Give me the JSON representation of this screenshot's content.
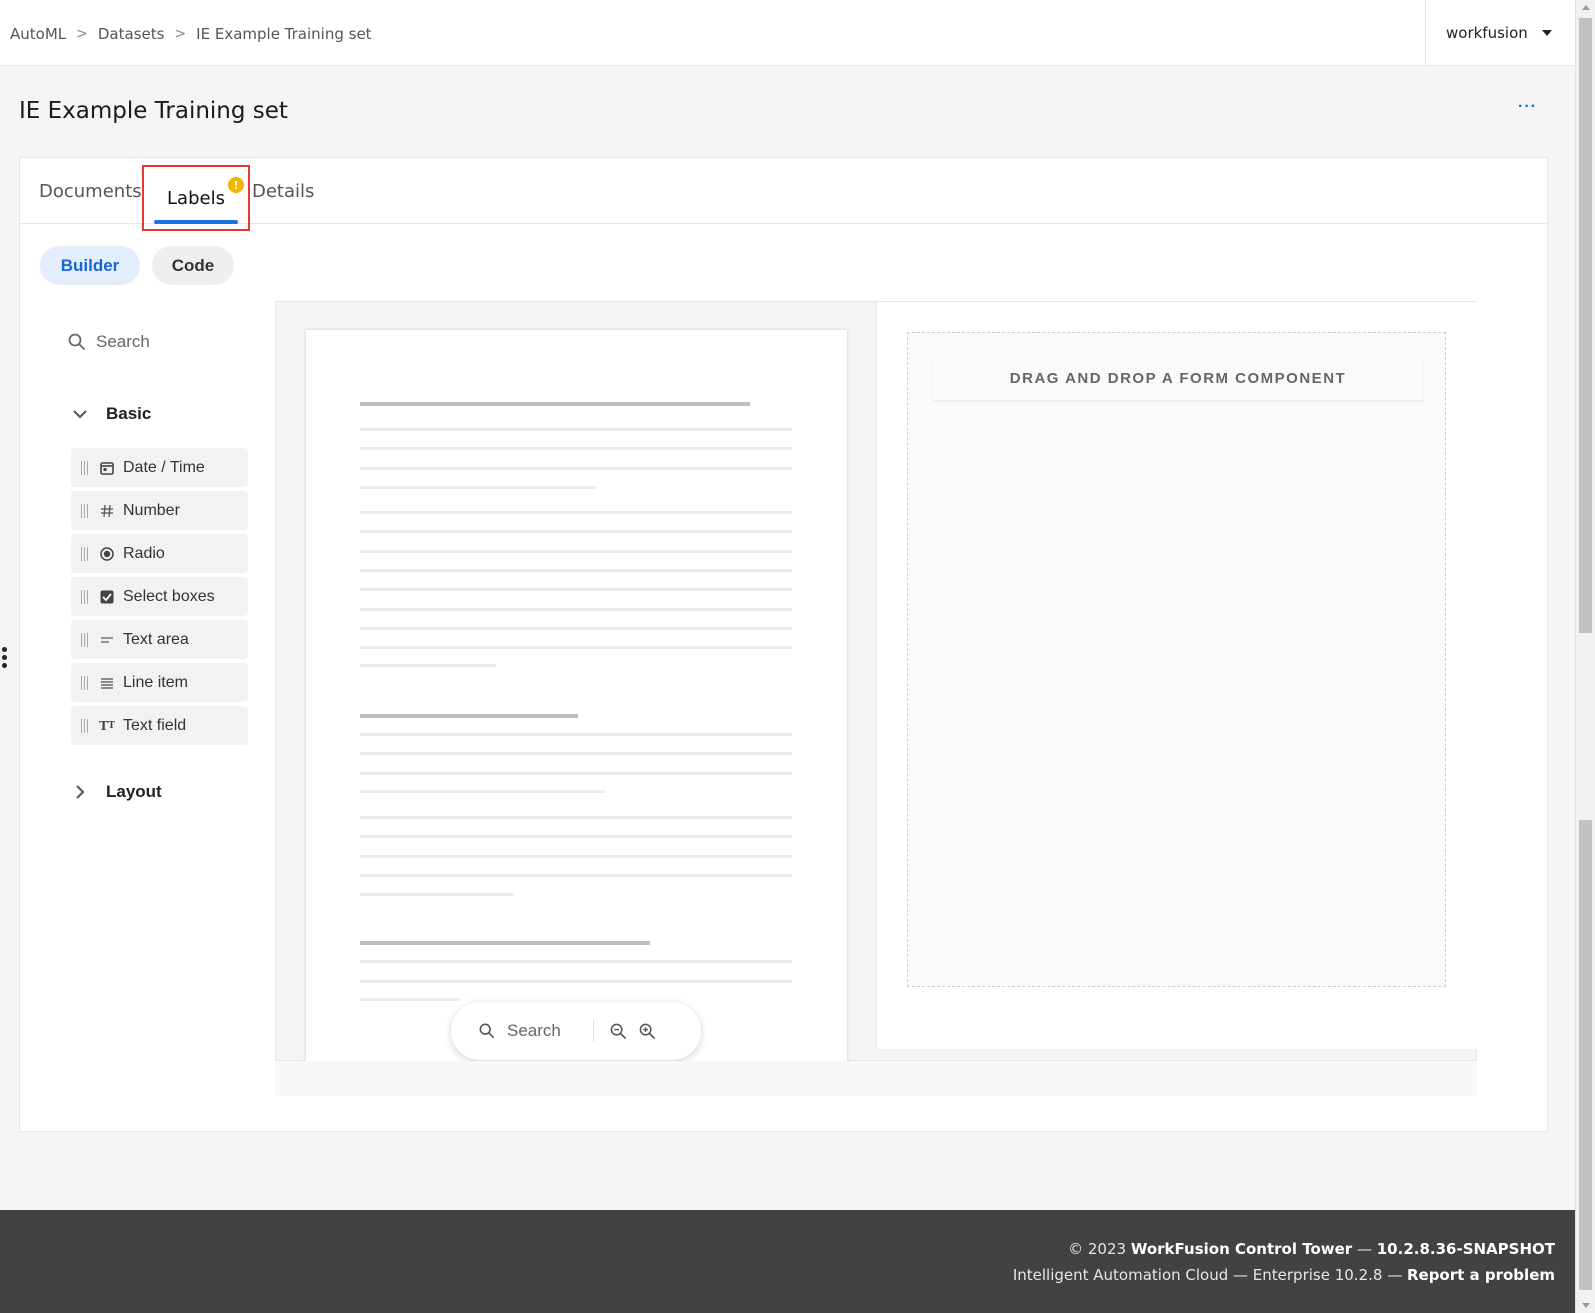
{
  "breadcrumb": [
    "AutoML",
    "Datasets",
    "IE Example Training set"
  ],
  "user": {
    "name": "workfusion"
  },
  "page": {
    "title": "IE Example Training set",
    "more_label": "···"
  },
  "tabs": [
    {
      "label": "Documents"
    },
    {
      "label": "Labels",
      "badge": "!"
    },
    {
      "label": "Details"
    }
  ],
  "modes": {
    "builder": "Builder",
    "code": "Code"
  },
  "sidebar": {
    "search_placeholder": "Search",
    "groups": {
      "basic": "Basic",
      "layout": "Layout"
    },
    "components": [
      {
        "label": "Date / Time",
        "icon": "calendar-icon"
      },
      {
        "label": "Number",
        "icon": "hash-icon"
      },
      {
        "label": "Radio",
        "icon": "radio-icon"
      },
      {
        "label": "Select boxes",
        "icon": "checkbox-icon"
      },
      {
        "label": "Text area",
        "icon": "text-area-icon"
      },
      {
        "label": "Line item",
        "icon": "list-lines-icon"
      },
      {
        "label": "Text field",
        "icon": "text-field-icon"
      }
    ]
  },
  "document_toolbar": {
    "search_placeholder": "Search"
  },
  "form": {
    "drop_label": "DRAG AND DROP A FORM COMPONENT"
  },
  "footer": {
    "copyright": "© 2023",
    "product": "WorkFusion Control Tower",
    "dash1": " — ",
    "version": "10.2.8.36-SNAPSHOT",
    "edition": "Intelligent Automation Cloud — Enterprise 10.2.8 — ",
    "report": "Report a problem"
  },
  "colors": {
    "accent": "#1a73e8",
    "warning": "#f4b400",
    "highlight": "#e53935",
    "footer_bg": "#424242"
  }
}
